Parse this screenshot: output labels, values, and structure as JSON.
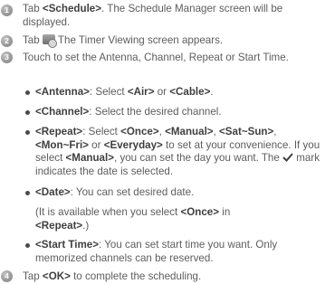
{
  "steps": [
    {
      "num": "1",
      "text_a": "Tab ",
      "b1": "<Schedule>",
      "text_b": ". The Schedule Manager screen will be displayed."
    },
    {
      "num": "2",
      "text_a": "Tab ",
      "text_b": " The Timer Viewing screen appears."
    },
    {
      "num": "3",
      "text_a": "Touch to set the Antenna, Channel, Repeat or Start Time."
    },
    {
      "num": "4",
      "text_a": "Tap ",
      "b1": "<OK>",
      "text_b": " to complete the scheduling."
    }
  ],
  "bullets": {
    "antenna": {
      "b1": "<Antenna>",
      "t1": ": Select ",
      "b2": "<Air>",
      "t2": " or ",
      "b3": "<Cable>",
      "t3": "."
    },
    "channel": {
      "b1": "<Channel>",
      "t1": ": Select the desired channel."
    },
    "repeat": {
      "b1": "<Repeat>",
      "t1": ": Select ",
      "b2": "<Once>",
      "t2": ", ",
      "b3": "<Manual>",
      "t3": ", ",
      "b4": "<Sat~Sun>",
      "t4": ",",
      "b5": "<Mon~Fri>",
      "t5": " or ",
      "b6": "<Everyday>",
      "t6": " to set at your convenience. If you select ",
      "b7": "<Manual>",
      "t7": ", you can set the day you want. The ",
      "t8": " mark indicates the date is selected."
    },
    "date": {
      "b1": "<Date>",
      "t1": ": You can set desired date.",
      "note_a": "(It is available when you select ",
      "note_b1": "<Once>",
      "note_b": " in ",
      "note_b2": "<Repeat>",
      "note_c": ".)"
    },
    "start_time": {
      "b1": "<Start Time>",
      "t1": ": You can set start time you want. Only memorized channels can be reserved."
    }
  },
  "icons": {
    "step2": "timer-tv-icon",
    "checkmark": "checkmark-icon"
  },
  "colors": {
    "text": "#5d5d5d",
    "bold": "#3f3f3f",
    "step_circle": "#9a9a9a"
  }
}
